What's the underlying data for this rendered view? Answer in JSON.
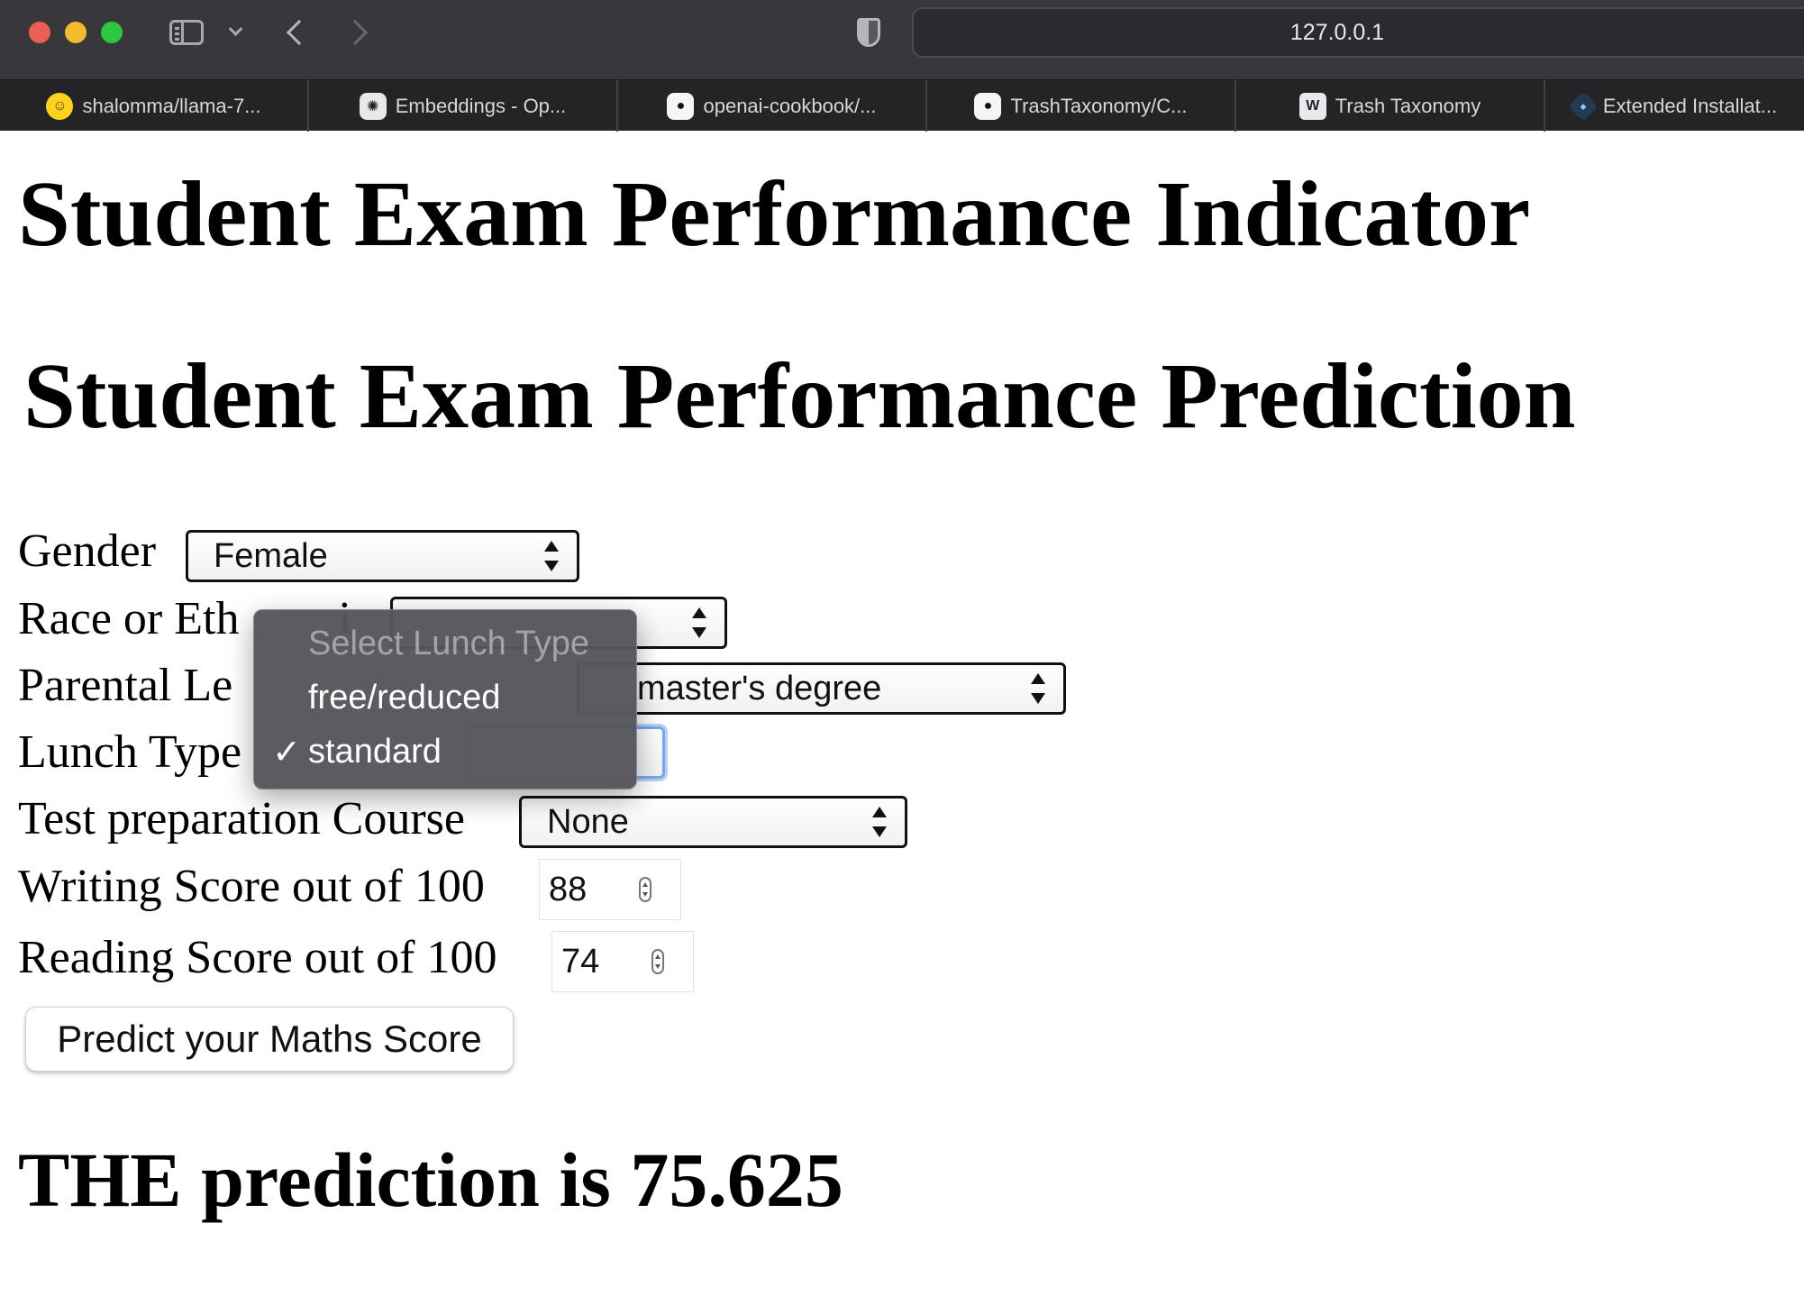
{
  "browser": {
    "url": "127.0.0.1",
    "tabs": [
      {
        "label": "shalomma/llama-7...",
        "icon": "huggingface-icon"
      },
      {
        "label": "Embeddings - Op...",
        "icon": "openai-icon"
      },
      {
        "label": "openai-cookbook/...",
        "icon": "github-icon"
      },
      {
        "label": "TrashTaxonomy/C...",
        "icon": "github-icon"
      },
      {
        "label": "Trash Taxonomy",
        "icon": "w-logo-icon"
      },
      {
        "label": "Extended Installat...",
        "icon": "extension-icon"
      }
    ]
  },
  "page": {
    "title": "Student Exam Performance Indicator",
    "subtitle": "Student Exam Performance Prediction",
    "form": {
      "gender": {
        "label": "Gender",
        "value": "Female"
      },
      "race": {
        "label": "Race or Eth",
        "label_end": "i",
        "value": ""
      },
      "parental": {
        "label": "Parental Le",
        "value": "master's degree"
      },
      "lunch": {
        "label": "Lunch Type",
        "value": "standard",
        "options": [
          "Select Lunch Type",
          "free/reduced",
          "standard"
        ],
        "check": "✓"
      },
      "test_prep": {
        "label": "Test preparation Course",
        "value": "None"
      },
      "writing": {
        "label": "Writing Score out of 100",
        "value": "88"
      },
      "reading": {
        "label": "Reading Score out of 100",
        "value": "74"
      },
      "submit_label": "Predict your Maths Score"
    },
    "result": "THE prediction is 75.625"
  }
}
